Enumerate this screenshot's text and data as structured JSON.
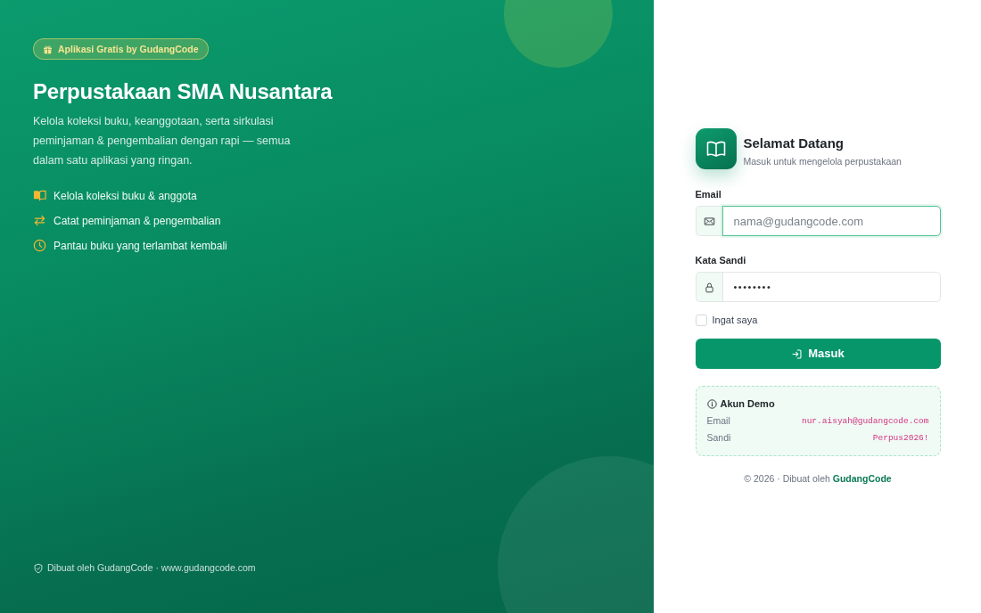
{
  "hero": {
    "badge": "Aplikasi Gratis by GudangCode",
    "title": "Perpustakaan SMA Nusantara",
    "description": "Kelola koleksi buku, keanggotaan, serta sirkulasi peminjaman & pengembalian dengan rapi — semua dalam satu aplikasi yang ringan.",
    "features": [
      {
        "kind": "book",
        "text": "Kelola koleksi buku & anggota"
      },
      {
        "kind": "swap",
        "text": "Catat peminjaman & pengembalian"
      },
      {
        "kind": "clock",
        "text": "Pantau buku yang terlambat kembali"
      }
    ],
    "footer": "Dibuat oleh GudangCode · www.gudangcode.com"
  },
  "login": {
    "title": "Selamat Datang",
    "subtitle": "Masuk untuk mengelola perpustakaan",
    "fields": [
      {
        "kind": "email",
        "label": "Email",
        "placeholder": "nama@gudangcode.com",
        "focused": true
      },
      {
        "kind": "password",
        "label": "Kata Sandi",
        "value": "••••••••",
        "focused": false
      }
    ],
    "remember": {
      "label": "Ingat saya",
      "checked": false
    },
    "submit": "Masuk",
    "demo": {
      "title": "Akun Demo",
      "rows": [
        {
          "label": "Email",
          "value": "nur.aisyah@gudangcode.com"
        },
        {
          "label": "Sandi",
          "value": "Perpus2026!"
        }
      ]
    },
    "footer": {
      "text": "© 2026 · Dibuat oleh",
      "link": "GudangCode"
    }
  }
}
